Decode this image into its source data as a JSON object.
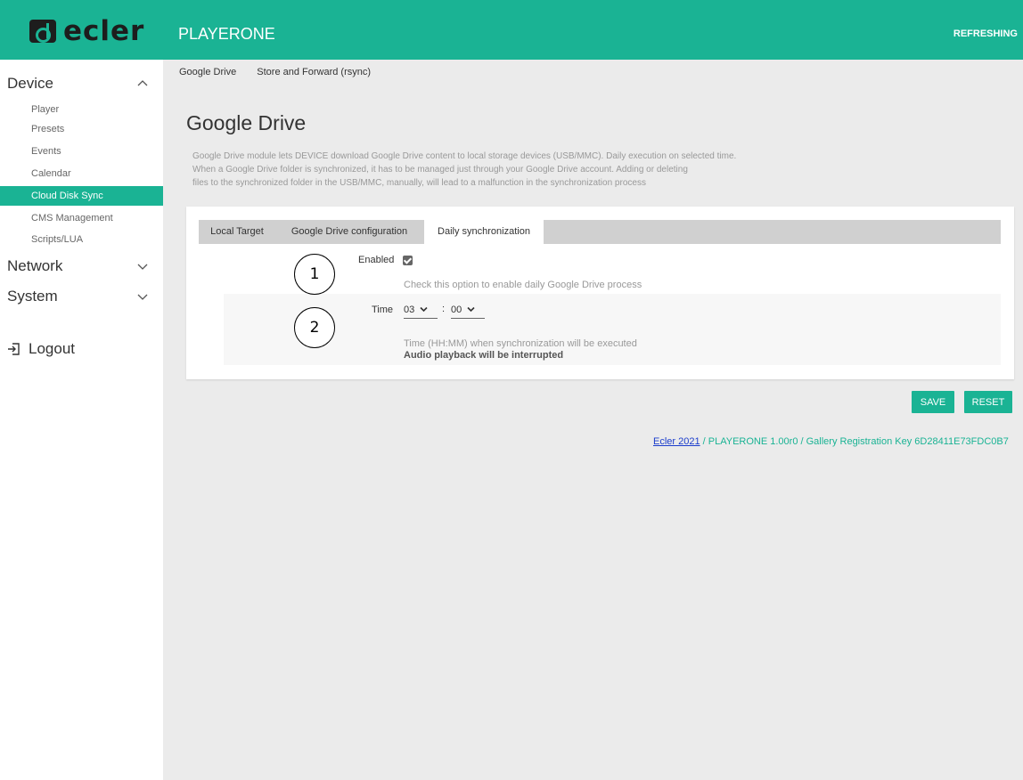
{
  "brand": {
    "logo_text": "ecler"
  },
  "header": {
    "app_title": "PLAYERONE",
    "status": "REFRESHING"
  },
  "sidebar": {
    "sections": [
      {
        "label": "Device",
        "expanded": true
      },
      {
        "label": "Network",
        "expanded": false
      },
      {
        "label": "System",
        "expanded": false
      }
    ],
    "device_items": [
      "Player",
      "Presets",
      "Events",
      "Calendar",
      "Cloud Disk Sync",
      "CMS Management",
      "Scripts/LUA"
    ],
    "active_item": "Cloud Disk Sync",
    "logout": "Logout"
  },
  "subnav": {
    "items": [
      "Google Drive",
      "Store and Forward (rsync)"
    ]
  },
  "page": {
    "title": "Google Drive",
    "description": [
      "Google Drive module lets DEVICE download Google Drive content to local storage devices (USB/MMC). Daily execution on selected time.",
      "When a Google Drive folder is synchronized, it has to be managed just through your Google Drive account. Adding or deleting",
      "files to the synchronized folder in the USB/MMC, manually, will lead to a malfunction in the synchronization process"
    ]
  },
  "tabs": [
    {
      "label": "Local Target",
      "active": false
    },
    {
      "label": "Google Drive configuration",
      "active": false
    },
    {
      "label": "Daily synchronization",
      "active": true
    }
  ],
  "daily": {
    "enabled_label": "Enabled",
    "enabled": true,
    "enabled_hint": "Check this option to enable daily Google Drive process",
    "time_label": "Time",
    "hour": "03",
    "minute": "00",
    "separator": ":",
    "time_hint": "Time (HH:MM) when synchronization will be executed",
    "time_warning": "Audio playback will be interrupted"
  },
  "callouts": [
    "1",
    "2"
  ],
  "actions": {
    "save": "SAVE",
    "reset": "RESET"
  },
  "footer": {
    "link": "Ecler 2021",
    "text": " / PLAYERONE 1.00r0 / Gallery Registration Key 6D28411E73FDC0B7"
  },
  "colors": {
    "accent": "#1ab394",
    "background": "#ebebeb",
    "sidebar": "#ffffff"
  }
}
